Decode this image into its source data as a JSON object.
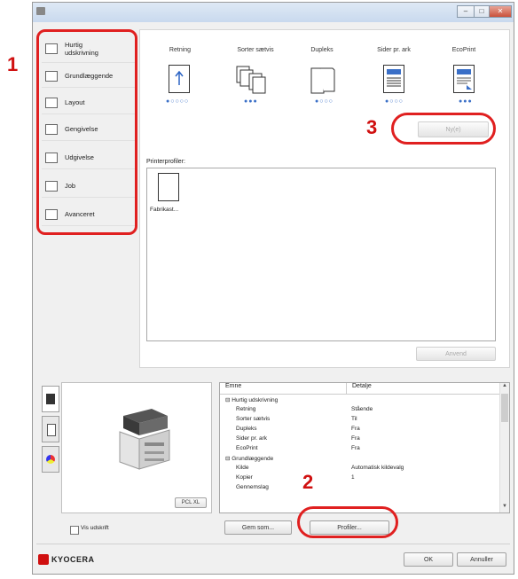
{
  "annotations": {
    "n1": "1",
    "n2": "2",
    "n3": "3"
  },
  "window": {
    "minimize": "–",
    "maximize": "□",
    "close": "✕"
  },
  "sidebar": {
    "items": [
      {
        "label": "Hurtig udskrivning",
        "icon": "quick-print-icon"
      },
      {
        "label": "Grundlæggende",
        "icon": "basic-icon"
      },
      {
        "label": "Layout",
        "icon": "layout-icon"
      },
      {
        "label": "Gengivelse",
        "icon": "imaging-icon"
      },
      {
        "label": "Udgivelse",
        "icon": "publishing-icon"
      },
      {
        "label": "Job",
        "icon": "job-icon"
      },
      {
        "label": "Avanceret",
        "icon": "advanced-icon"
      }
    ]
  },
  "quick_print": {
    "columns": [
      {
        "label": "Retning",
        "dots": "●○○○○"
      },
      {
        "label": "Sorter sætvis",
        "dots": "●●●"
      },
      {
        "label": "Dupleks",
        "dots": "●○○○"
      },
      {
        "label": "Sider pr. ark",
        "dots": "●○○○"
      },
      {
        "label": "EcoPrint",
        "dots": "●●●"
      }
    ],
    "new_button": "Ny(e)"
  },
  "profiles": {
    "label": "Printerprofiler:",
    "items": [
      {
        "label": "Fabrikast..."
      }
    ],
    "apply_button": "Anvend"
  },
  "summary": {
    "col_item": "Emne",
    "col_details": "Detalje",
    "rows": [
      {
        "indent": 0,
        "item": "⊟ Hurtig udskrivning",
        "detail": ""
      },
      {
        "indent": 1,
        "item": "Retning",
        "detail": "Stående"
      },
      {
        "indent": 1,
        "item": "Sorter sætvis",
        "detail": "Til"
      },
      {
        "indent": 1,
        "item": "Dupleks",
        "detail": "Fra"
      },
      {
        "indent": 1,
        "item": "Sider pr. ark",
        "detail": "Fra"
      },
      {
        "indent": 1,
        "item": "EcoPrint",
        "detail": "Fra"
      },
      {
        "indent": 0,
        "item": "⊟ Grundlæggende",
        "detail": ""
      },
      {
        "indent": 1,
        "item": "Kilde",
        "detail": "Automatisk kildevalg"
      },
      {
        "indent": 1,
        "item": "Kopier",
        "detail": "1"
      },
      {
        "indent": 1,
        "item": "Gennemslag",
        "detail": ""
      }
    ]
  },
  "printer": {
    "pdl": "PCL XL"
  },
  "bottom": {
    "checkbox_label": "Vis udskrift",
    "save_as": "Gem som...",
    "profiles": "Profiler...",
    "ok": "OK",
    "cancel": "Annuller",
    "brand": "KYOCERA"
  }
}
